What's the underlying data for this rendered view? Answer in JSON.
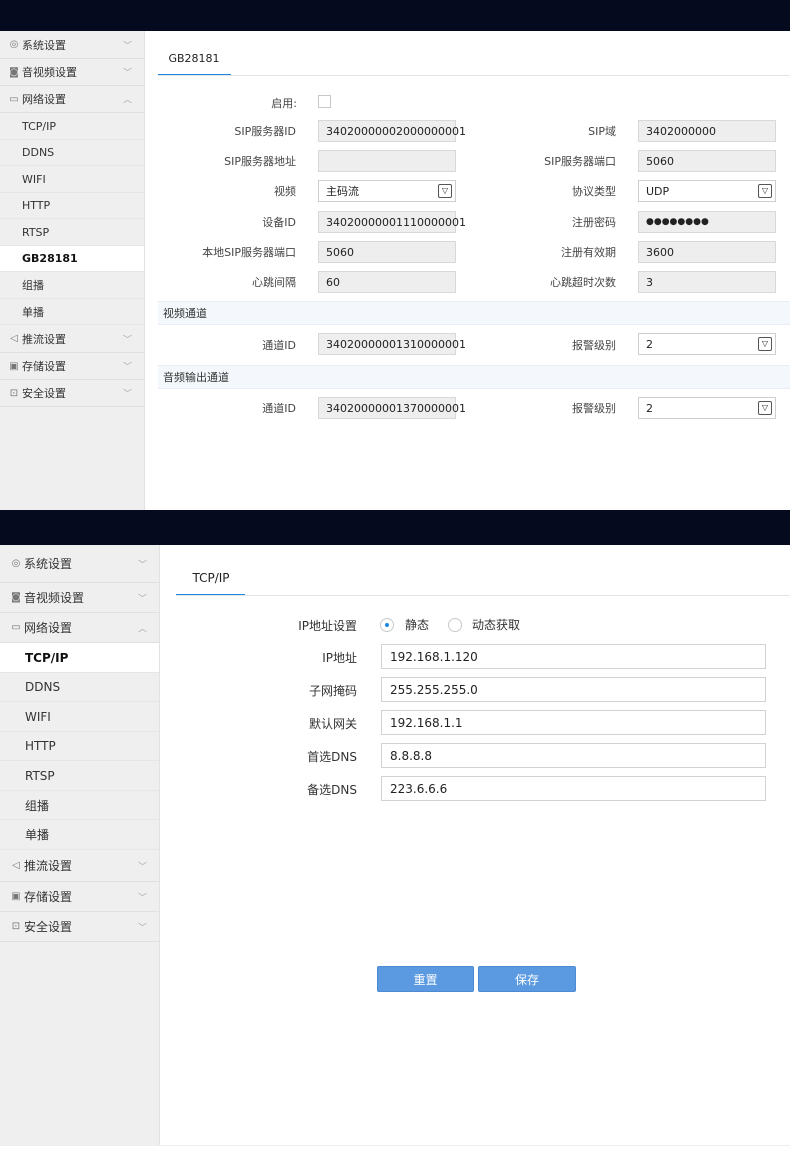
{
  "sidebar": {
    "system": "系统设置",
    "av": "音视频设置",
    "network": "网络设置",
    "network_items": [
      "TCP/IP",
      "DDNS",
      "WIFI",
      "HTTP",
      "RTSP",
      "GB28181",
      "组播",
      "单播"
    ],
    "stream": "推流设置",
    "storage": "存储设置",
    "security": "安全设置"
  },
  "icons": {
    "system": "gear-icon",
    "av": "camera-icon",
    "network": "monitor-icon",
    "stream": "send-icon",
    "storage": "save-icon",
    "security": "lock-icon",
    "expand": "chevron-down-icon",
    "collapse": "chevron-up-icon"
  },
  "accent_color": "#1e88e5",
  "gb": {
    "tab": "GB28181",
    "enable_label": "启用:",
    "sip_server_id_label": "SIP服务器ID",
    "sip_server_id": "34020000002000000001",
    "sip_domain_label": "SIP域",
    "sip_domain": "3402000000",
    "sip_server_addr_label": "SIP服务器地址",
    "sip_server_addr": "",
    "sip_server_port_label": "SIP服务器端口",
    "sip_server_port": "5060",
    "video_label": "视频",
    "video_value": "主码流",
    "protocol_label": "协议类型",
    "protocol_value": "UDP",
    "device_id_label": "设备ID",
    "device_id": "34020000001110000001",
    "reg_pwd_label": "注册密码",
    "reg_pwd": "●●●●●●●●",
    "local_port_label": "本地SIP服务器端口",
    "local_port": "5060",
    "reg_valid_label": "注册有效期",
    "reg_valid": "3600",
    "heartbeat_label": "心跳间隔",
    "heartbeat": "60",
    "heartbeat_timeout_label": "心跳超时次数",
    "heartbeat_timeout": "3",
    "video_channel_section": "视频通道",
    "vchannel_id_label": "通道ID",
    "vchannel_id": "34020000001310000001",
    "valarm_label": "报警级别",
    "valarm": "2",
    "audio_channel_section": "音频输出通道",
    "achannel_id_label": "通道ID",
    "achannel_id": "34020000001370000001",
    "aalarm_label": "报警级别",
    "aalarm": "2"
  },
  "tcp": {
    "tab": "TCP/IP",
    "ip_setting_label": "IP地址设置",
    "static_label": "静态",
    "dhcp_label": "动态获取",
    "ip_label": "IP地址",
    "ip": "192.168.1.120",
    "mask_label": "子网掩码",
    "mask": "255.255.255.0",
    "gateway_label": "默认网关",
    "gateway": "192.168.1.1",
    "dns1_label": "首选DNS",
    "dns1": "8.8.8.8",
    "dns2_label": "备选DNS",
    "dns2": "223.6.6.6",
    "reset_label": "重置",
    "save_label": "保存"
  }
}
